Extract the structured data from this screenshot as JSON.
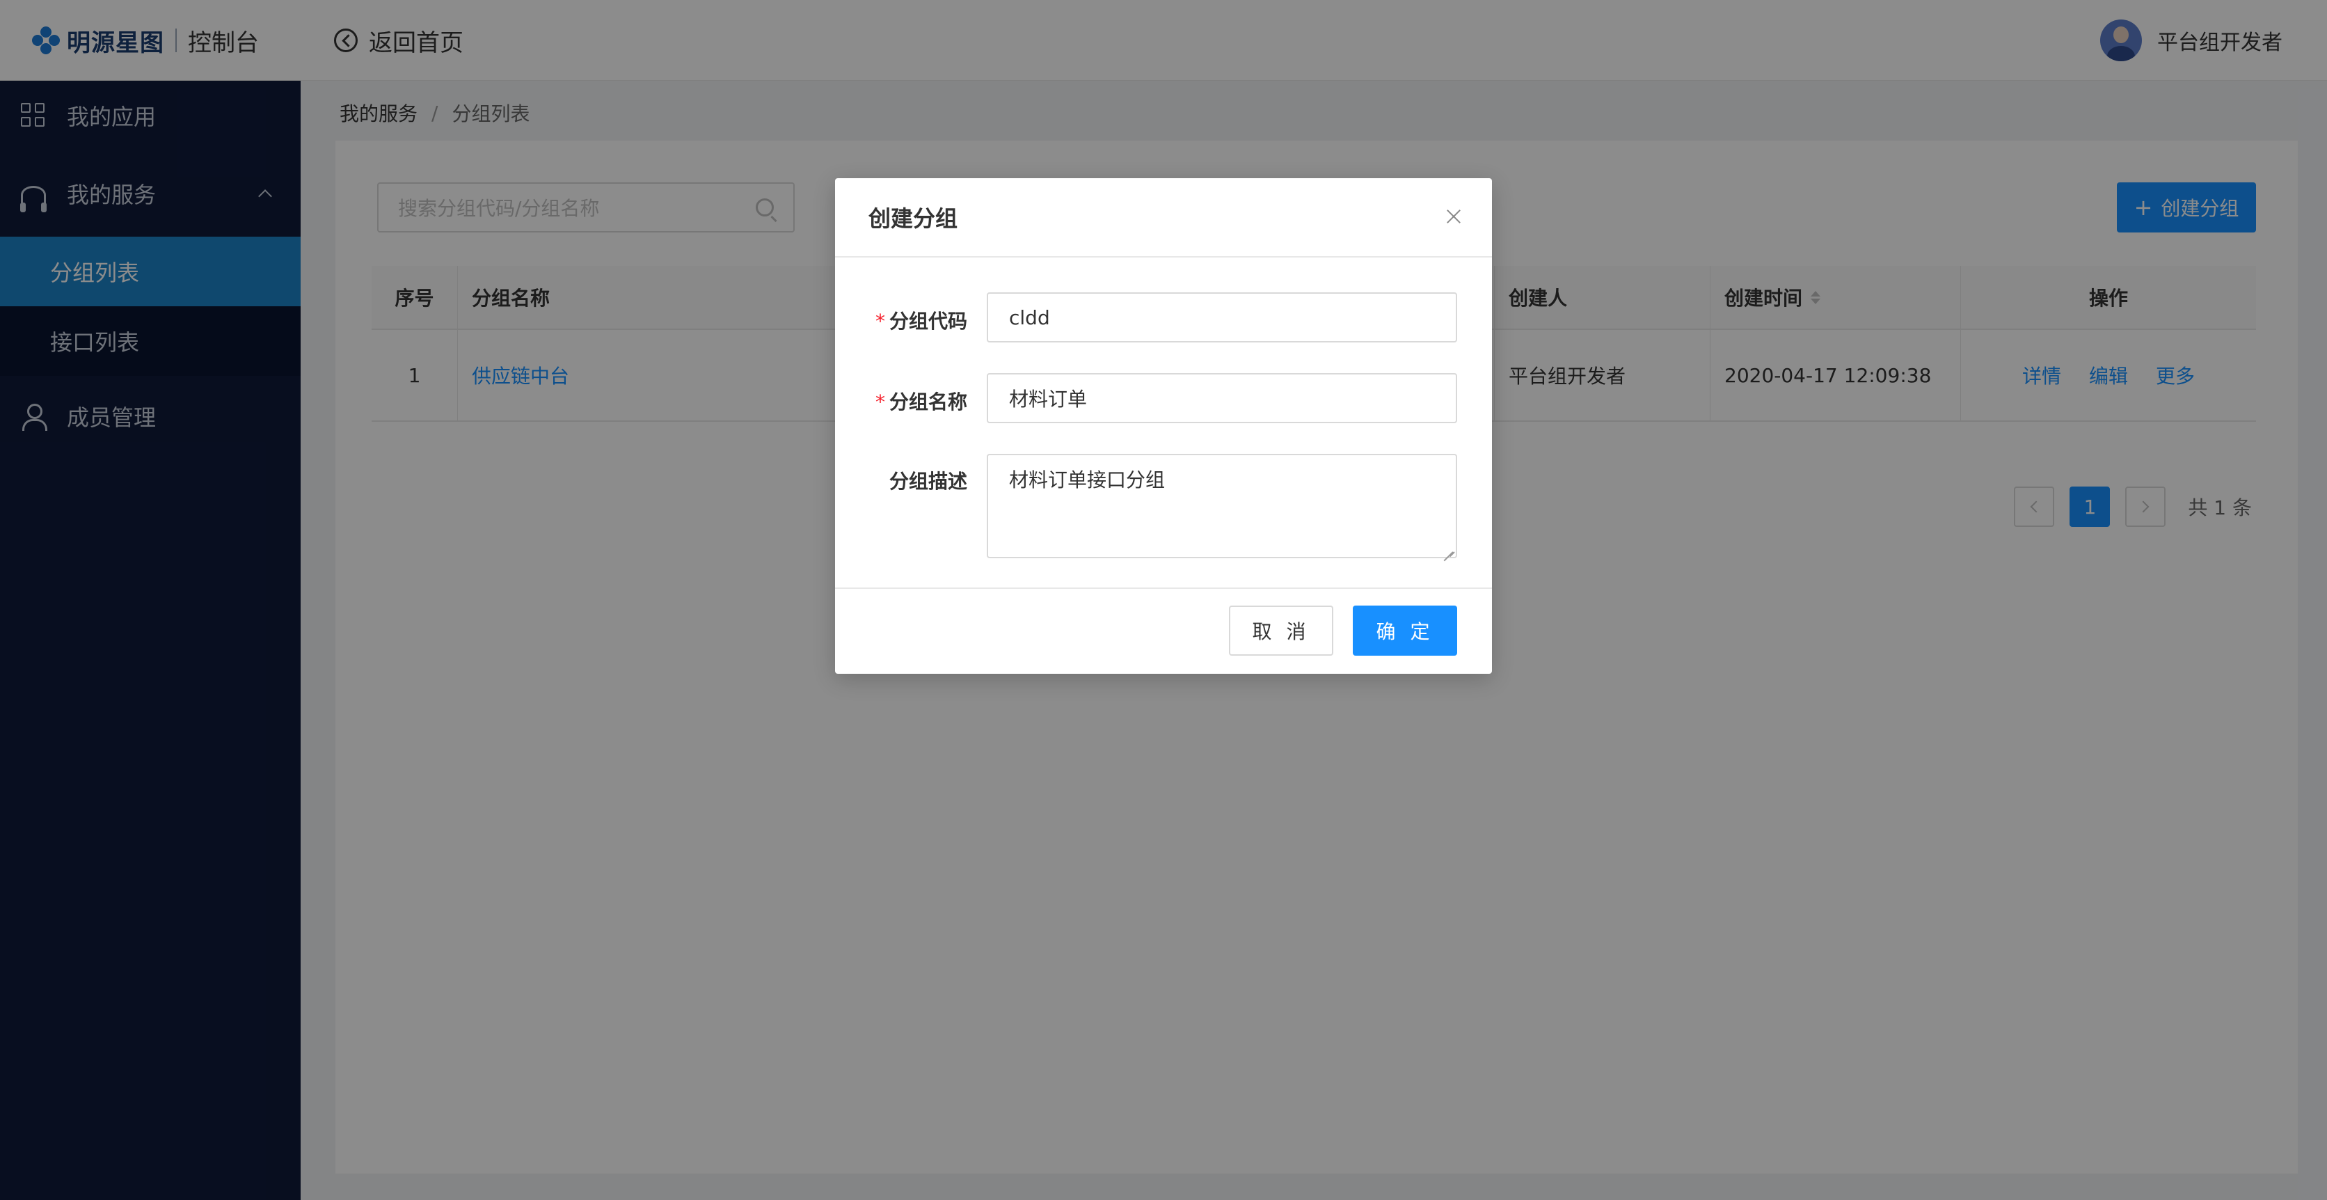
{
  "header": {
    "logo_text": "明源星图",
    "logo_sub": "控制台",
    "back_home": "返回首页",
    "user_name": "平台组开发者"
  },
  "sidebar": {
    "items": [
      {
        "label": "我的应用",
        "icon": "grid-icon"
      },
      {
        "label": "我的服务",
        "icon": "headset-icon",
        "expanded": true
      },
      {
        "label": "分组列表",
        "active": true
      },
      {
        "label": "接口列表"
      },
      {
        "label": "成员管理",
        "icon": "person-icon"
      }
    ]
  },
  "breadcrumb": {
    "level1": "我的服务",
    "separator": "/",
    "level2": "分组列表"
  },
  "toolbar": {
    "search_placeholder": "搜索分组代码/分组名称",
    "create_label": "创建分组"
  },
  "table": {
    "columns": [
      "序号",
      "分组名称",
      "创建人",
      "创建时间",
      "操作"
    ],
    "rows": [
      {
        "index": "1",
        "name": "供应链中台",
        "creator": "平台组开发者",
        "time": "2020-04-17 12:09:38",
        "ops": [
          "详情",
          "编辑",
          "更多"
        ]
      }
    ]
  },
  "pagination": {
    "current": "1",
    "total": "共 1 条"
  },
  "modal": {
    "title": "创建分组",
    "fields": {
      "code_label": "分组代码",
      "code_value": "cldd",
      "name_label": "分组名称",
      "name_value": "材料订单",
      "desc_label": "分组描述",
      "desc_value": "材料订单接口分组",
      "required_mark": "*"
    },
    "cancel_label": "取 消",
    "ok_label": "确 定"
  },
  "colors": {
    "primary": "#1890ff",
    "sidebar_bg": "#0f1a3a",
    "sidebar_active": "#1c84c8",
    "required": "#f5222d"
  }
}
